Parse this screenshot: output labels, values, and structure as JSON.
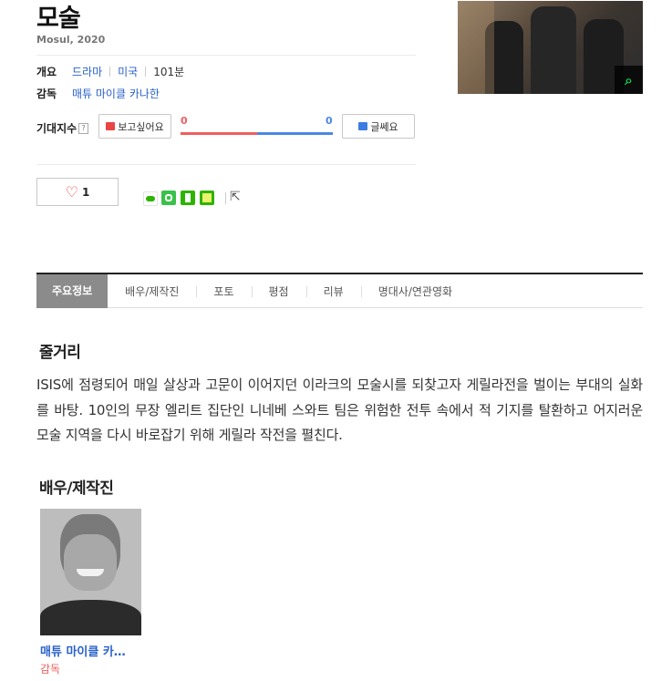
{
  "movie": {
    "title": "모술",
    "subtitle": "Mosul, 2020"
  },
  "info": {
    "overview_label": "개요",
    "genre": "드라마",
    "country": "미국",
    "runtime": "101분",
    "director_label": "감독",
    "director": "매튜 마이클 카나한"
  },
  "expectation": {
    "label": "기대지수",
    "help": "?",
    "want_label": "보고싶어요",
    "meh_label": "글쎄요",
    "want_count": "0",
    "meh_count": "0",
    "want_ratio": 0.5
  },
  "like": {
    "count": "1"
  },
  "share_icons": [
    "naver-blog-icon",
    "band-icon",
    "bookmark-icon",
    "kakao-icon"
  ],
  "colors": {
    "accent_red": "#ef5f60",
    "accent_blue": "#4b87e4",
    "link": "#2a62c9",
    "active_tab": "#8b8b8b",
    "zoom_icon": "#18c94a"
  },
  "tabs": [
    "주요정보",
    "배우/제작진",
    "포토",
    "평점",
    "리뷰",
    "명대사/연관영화"
  ],
  "synopsis": {
    "heading": "줄거리",
    "text": "ISIS에 점령되어 매일 살상과 고문이 이어지던 이라크의 모술시를 되찾고자 게릴라전을 벌이는 부대의 실화를 바탕. 10인의 무장 엘리트 집단인 니네베 스와트 팀은 위험한 전투 속에서 적 기지를 탈환하고 어지러운 모술 지역을 다시 바로잡기 위해 게릴라 작전을 펼친다."
  },
  "cast": {
    "heading": "배우/제작진",
    "members": [
      {
        "name": "매튜 마이클 카…",
        "role": "감독"
      }
    ]
  }
}
